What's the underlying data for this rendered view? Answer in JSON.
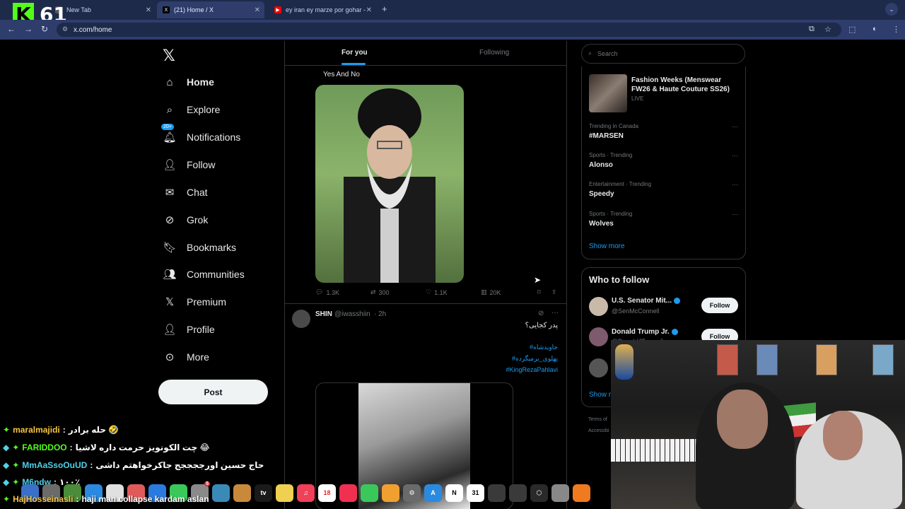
{
  "stream": {
    "viewer_count": "61",
    "badge_letter": "K"
  },
  "browser": {
    "tabs": [
      {
        "label": "New Tab",
        "active": false
      },
      {
        "label": "(21) Home / X",
        "active": true
      },
      {
        "label": "ey iran ey marze por gohar -",
        "active": false
      }
    ],
    "url": "x.com/home"
  },
  "left_nav": {
    "items": [
      {
        "label": "Home",
        "icon": "home-icon",
        "glyph": "⌂"
      },
      {
        "label": "Explore",
        "icon": "search-icon",
        "glyph": "⌕"
      },
      {
        "label": "Notifications",
        "icon": "bell-icon",
        "glyph": "🔔︎",
        "badge": "20+"
      },
      {
        "label": "Follow",
        "icon": "add-person-icon",
        "glyph": "👤︎"
      },
      {
        "label": "Chat",
        "icon": "mail-icon",
        "glyph": "✉"
      },
      {
        "label": "Grok",
        "icon": "grok-icon",
        "glyph": "⊘"
      },
      {
        "label": "Bookmarks",
        "icon": "bookmark-icon",
        "glyph": "🔖︎"
      },
      {
        "label": "Communities",
        "icon": "communities-icon",
        "glyph": "👥︎"
      },
      {
        "label": "Premium",
        "icon": "x-premium-icon",
        "glyph": "𝕏"
      },
      {
        "label": "Profile",
        "icon": "person-icon",
        "glyph": "👤︎"
      },
      {
        "label": "More",
        "icon": "more-circle-icon",
        "glyph": "⊙"
      }
    ],
    "post_button": "Post"
  },
  "feed": {
    "tabs": [
      "For you",
      "Following"
    ],
    "post1": {
      "text": "Yes And No",
      "stats": {
        "replies": "1.3K",
        "reposts": "300",
        "likes": "1.1K",
        "views": "20K"
      }
    },
    "post2": {
      "name": "SHIN",
      "handle": "@iwasshiin",
      "time": "· 2h",
      "text": "پدر کجایی؟",
      "hashtags": [
        "#جاویدشاه",
        "#پهلوی_برمیگرده",
        "#KingRezaPahlavi"
      ]
    }
  },
  "right": {
    "search_placeholder": "Search",
    "trending": [
      {
        "category": "",
        "name": "Fashion Weeks (Menswear FW26 & Haute Couture SS26)",
        "status": "LIVE"
      },
      {
        "category": "Trending in Canada",
        "name": "#MARSEN"
      },
      {
        "category": "Sports · Trending",
        "name": "Alonso"
      },
      {
        "category": "Entertainment · Trending",
        "name": "Speedy"
      },
      {
        "category": "Sports · Trending",
        "name": "Wolves"
      }
    ],
    "show_more": "Show more",
    "who_to_follow": {
      "title": "Who to follow",
      "accounts": [
        {
          "name": "U.S. Senator Mit...",
          "handle": "@SenMcConnell"
        },
        {
          "name": "Donald Trump Jr.",
          "handle": "@DonaldJTrumpJr"
        }
      ],
      "follow_label": "Follow",
      "show_more_partial": "Show r"
    },
    "footer_partial": [
      "Terms of",
      "Accessibi"
    ]
  },
  "chat": [
    {
      "user": "maralmajidi",
      "message": "حله برادر 🤣",
      "color": "gold"
    },
    {
      "user": "FARIDDOO",
      "message": "چت الکونویز حرمت داره لاشیا 😂",
      "color": "green"
    },
    {
      "user": "MmAaSsoOuUD",
      "message": "حاج حسین اورججججج جاکرخواهتم داشی",
      "color": "cyan"
    },
    {
      "user": "M6ndw",
      "message": "۱۰۰٪",
      "color": "cyan"
    },
    {
      "user": "HajHosseinasli",
      "message": "haji man collapse kardam aslan",
      "color": "gold"
    }
  ],
  "dock": {
    "calendar_day": "18",
    "calendar_day2": "31",
    "apple_tv": "tv",
    "badge_number": "5"
  },
  "colors": {
    "accent": "#1d9bf0",
    "kick_green": "#53fc18",
    "background": "#000000"
  }
}
